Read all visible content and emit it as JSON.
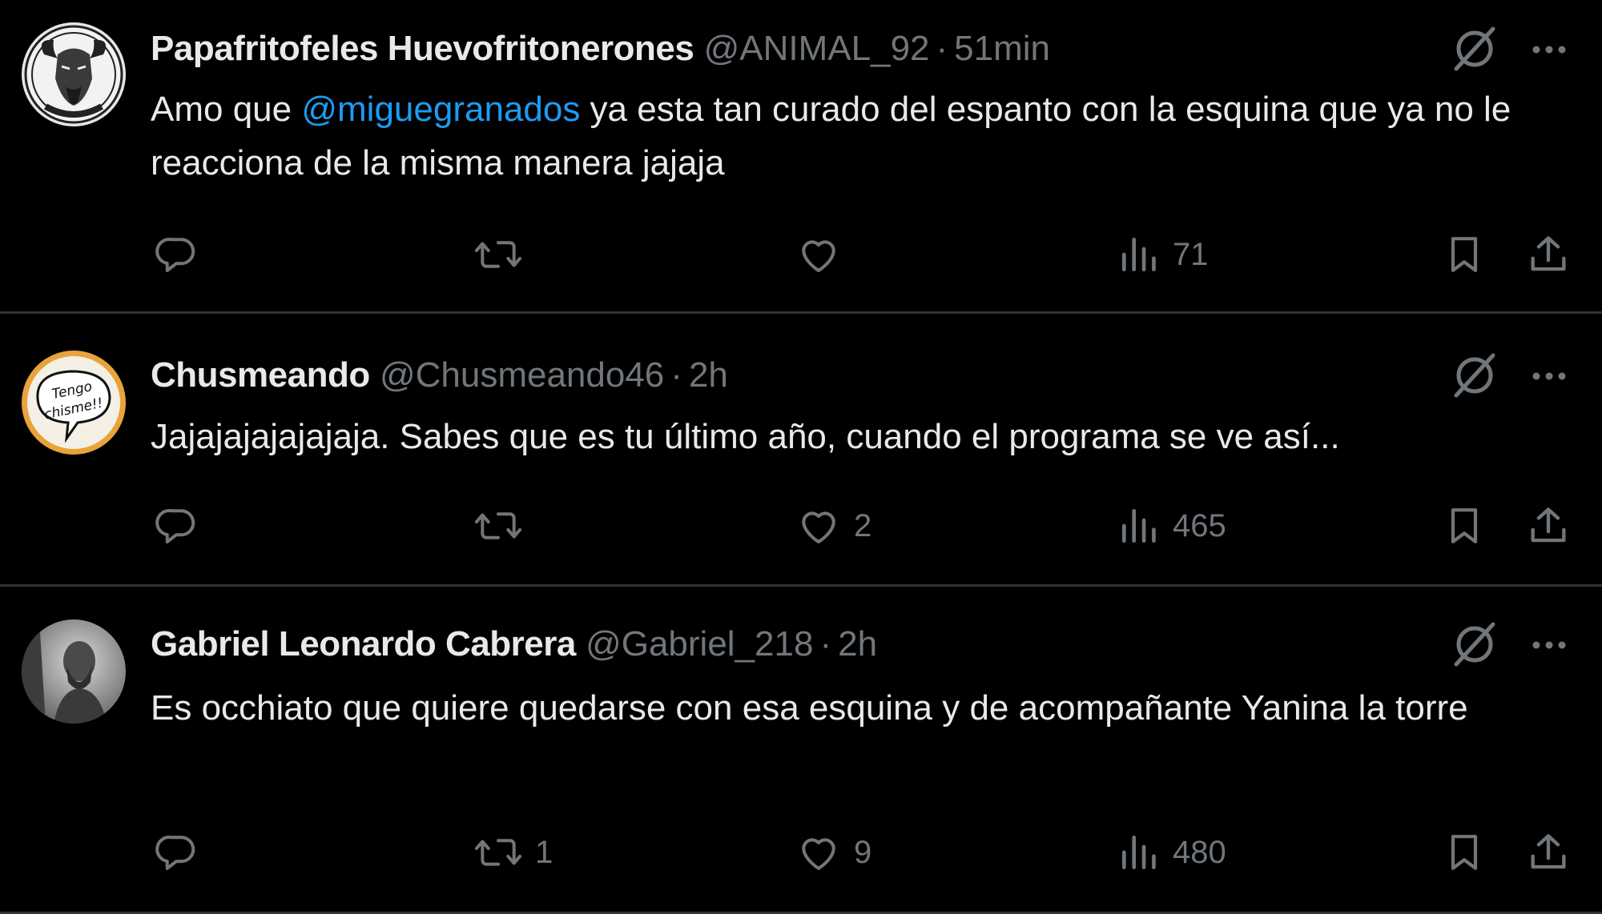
{
  "posts": [
    {
      "name": "Papafritofeles Huevofritonerones",
      "handle": "@ANIMAL_92",
      "separator": "·",
      "time": "51min",
      "text_parts": [
        "Amo que ",
        "@miguegranados",
        " ya esta tan curado del espanto con la esquina que ya no le reacciona de la misma manera jajaja"
      ],
      "replies": "",
      "reposts": "",
      "likes": "",
      "views": "71"
    },
    {
      "name": "Chusmeando",
      "handle": "@Chusmeando46",
      "separator": "·",
      "time": "2h",
      "text": "Jajajajajajajaja. Sabes que es tu último año, cuando el programa se ve así...",
      "replies": "",
      "reposts": "",
      "likes": "2",
      "views": "465",
      "avatar_text": [
        "Tengo",
        "chisme!!"
      ]
    },
    {
      "name": "Gabriel Leonardo Cabrera",
      "handle": "@Gabriel_218",
      "separator": "·",
      "time": "2h",
      "text": "Es occhiato que quiere quedarse con esa esquina y de acompañante Yanina la torre",
      "replies": "",
      "reposts": "1",
      "likes": "9",
      "views": "480"
    }
  ],
  "icons": {
    "reply": "reply-icon",
    "repost": "repost-icon",
    "like": "heart-icon",
    "views": "views-icon",
    "bookmark": "bookmark-icon",
    "share": "share-icon",
    "grok": "grok-icon",
    "more": "more-icon"
  },
  "colors": {
    "background": "#000000",
    "text": "#e7e9ea",
    "secondary": "#71767b",
    "link": "#1d9bf0",
    "divider": "#2f3336"
  }
}
